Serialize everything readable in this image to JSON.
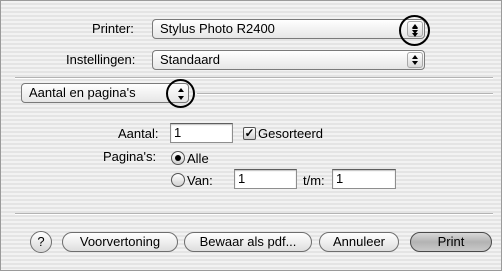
{
  "printer": {
    "label": "Printer:",
    "value": "Stylus Photo R2400"
  },
  "presets": {
    "label": "Instellingen:",
    "value": "Standaard"
  },
  "panel": {
    "value": "Aantal en pagina's"
  },
  "copies": {
    "label": "Aantal:",
    "value": "1",
    "collated_label": "Gesorteerd",
    "collated_checked": true,
    "check_mark": "✓"
  },
  "pages": {
    "label": "Pagina's:",
    "all_label": "Alle",
    "all_selected": true,
    "from_label": "Van:",
    "from_value": "1",
    "to_label": "t/m:",
    "to_value": "1"
  },
  "buttons": {
    "help": "?",
    "preview": "Voorvertoning",
    "save_pdf": "Bewaar als pdf...",
    "cancel": "Annuleer",
    "print": "Print"
  },
  "icons": {
    "popup_arrows": "up-down-arrows-icon",
    "help": "question-mark-icon"
  }
}
